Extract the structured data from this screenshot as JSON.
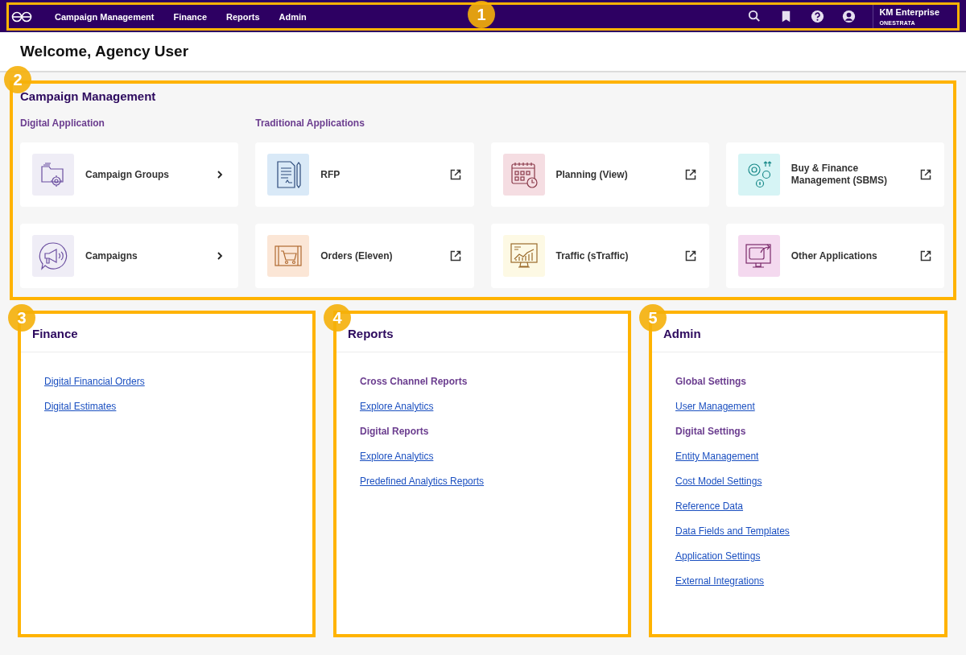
{
  "navbar": {
    "menu": [
      "Campaign Management",
      "Finance",
      "Reports",
      "Admin"
    ],
    "account": {
      "name": "KM Enterprise",
      "org": "ONESTRATA"
    },
    "callout": "1"
  },
  "welcome": "Welcome, Agency User",
  "campaign_management": {
    "title": "Campaign Management",
    "callout": "2",
    "groups": [
      {
        "heading": "Digital Application",
        "tiles": [
          {
            "label": "Campaign Groups",
            "kind": "internal",
            "color": "#efedf6"
          },
          {
            "label": "Campaigns",
            "kind": "internal",
            "color": "#efedf6"
          }
        ]
      },
      {
        "heading": "Traditional Applications",
        "tiles": [
          {
            "label": "RFP",
            "kind": "external",
            "color": "#d9e9f7"
          },
          {
            "label": "Planning (View)",
            "kind": "external",
            "color": "#f5dde2"
          },
          {
            "label": "Buy & Finance Management (SBMS)",
            "kind": "external",
            "color": "#d6f4f5"
          },
          {
            "label": "Orders (Eleven)",
            "kind": "external",
            "color": "#fbe6d6"
          },
          {
            "label": "Traffic (sTraffic)",
            "kind": "external",
            "color": "#fdf9e4"
          },
          {
            "label": "Other Applications",
            "kind": "external",
            "color": "#f4d9ef"
          }
        ]
      }
    ]
  },
  "panels": [
    {
      "title": "Finance",
      "callout": "3",
      "items": [
        {
          "kind": "link",
          "text": "Digital Financial Orders"
        },
        {
          "kind": "link",
          "text": "Digital Estimates"
        }
      ]
    },
    {
      "title": "Reports",
      "callout": "4",
      "items": [
        {
          "kind": "heading",
          "text": "Cross Channel Reports"
        },
        {
          "kind": "link",
          "text": "Explore Analytics"
        },
        {
          "kind": "heading",
          "text": "Digital Reports"
        },
        {
          "kind": "link",
          "text": "Explore Analytics"
        },
        {
          "kind": "link",
          "text": "Predefined Analytics Reports"
        }
      ]
    },
    {
      "title": "Admin",
      "callout": "5",
      "items": [
        {
          "kind": "heading",
          "text": "Global Settings"
        },
        {
          "kind": "link",
          "text": "User Management"
        },
        {
          "kind": "heading",
          "text": "Digital Settings"
        },
        {
          "kind": "link",
          "text": "Entity Management"
        },
        {
          "kind": "link",
          "text": "Cost Model Settings"
        },
        {
          "kind": "link",
          "text": "Reference Data"
        },
        {
          "kind": "link",
          "text": "Data Fields and Templates"
        },
        {
          "kind": "link",
          "text": "Application Settings"
        },
        {
          "kind": "link",
          "text": "External Integrations"
        }
      ]
    }
  ]
}
